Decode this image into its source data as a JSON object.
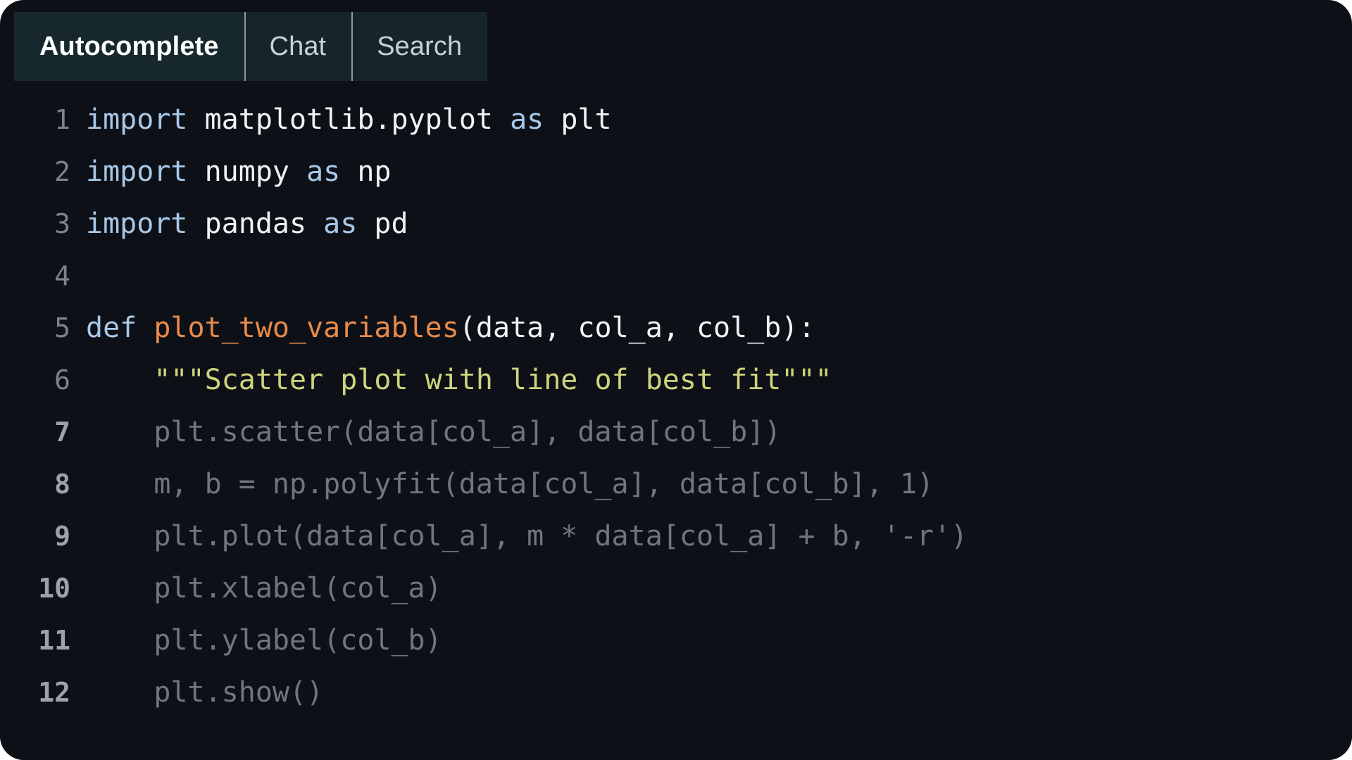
{
  "window": {
    "background_color": "#0d1117",
    "card_radius_px": 34
  },
  "tabs": {
    "active_index": 0,
    "background_color": "#16252b",
    "divider_color": "#8d9aa0",
    "items": [
      {
        "label": "Autocomplete",
        "active": true
      },
      {
        "label": "Chat",
        "active": false
      },
      {
        "label": "Search",
        "active": false
      }
    ]
  },
  "editor": {
    "language": "python",
    "colors": {
      "keyword": "#a8c8e8",
      "plain": "#f0f3f6",
      "function": "#e8894a",
      "docstring": "#cfd37c",
      "ghost_suggestion": "#6e767e",
      "line_number": "#7b848d",
      "line_number_ghost": "#9aa3ab"
    },
    "lines": [
      {
        "number": "1",
        "ghost": false,
        "tokens": [
          {
            "text": "import",
            "type": "kw"
          },
          {
            "text": " matplotlib.pyplot ",
            "type": "plain"
          },
          {
            "text": "as",
            "type": "kw"
          },
          {
            "text": " plt",
            "type": "plain"
          }
        ]
      },
      {
        "number": "2",
        "ghost": false,
        "tokens": [
          {
            "text": "import",
            "type": "kw"
          },
          {
            "text": " numpy ",
            "type": "plain"
          },
          {
            "text": "as",
            "type": "kw"
          },
          {
            "text": " np",
            "type": "plain"
          }
        ]
      },
      {
        "number": "3",
        "ghost": false,
        "tokens": [
          {
            "text": "import",
            "type": "kw"
          },
          {
            "text": " pandas ",
            "type": "plain"
          },
          {
            "text": "as",
            "type": "kw"
          },
          {
            "text": " pd",
            "type": "plain"
          }
        ]
      },
      {
        "number": "4",
        "ghost": false,
        "tokens": []
      },
      {
        "number": "5",
        "ghost": false,
        "tokens": [
          {
            "text": "def",
            "type": "kw"
          },
          {
            "text": " ",
            "type": "plain"
          },
          {
            "text": "plot_two_variables",
            "type": "fn"
          },
          {
            "text": "(data, col_a, col_b):",
            "type": "plain"
          }
        ]
      },
      {
        "number": "6",
        "ghost": false,
        "tokens": [
          {
            "text": "    ",
            "type": "plain"
          },
          {
            "text": "\"\"\"Scatter plot with line of best fit\"\"\"",
            "type": "doc"
          }
        ]
      },
      {
        "number": "7",
        "ghost": true,
        "tokens": [
          {
            "text": "    plt.scatter(data[col_a], data[col_b])",
            "type": "ghost"
          }
        ]
      },
      {
        "number": "8",
        "ghost": true,
        "tokens": [
          {
            "text": "    m, b = np.polyfit(data[col_a], data[col_b], 1)",
            "type": "ghost"
          }
        ]
      },
      {
        "number": "9",
        "ghost": true,
        "tokens": [
          {
            "text": "    plt.plot(data[col_a], m * data[col_a] + b, '-r')",
            "type": "ghost"
          }
        ]
      },
      {
        "number": "10",
        "ghost": true,
        "tokens": [
          {
            "text": "    plt.xlabel(col_a)",
            "type": "ghost"
          }
        ]
      },
      {
        "number": "11",
        "ghost": true,
        "tokens": [
          {
            "text": "    plt.ylabel(col_b)",
            "type": "ghost"
          }
        ]
      },
      {
        "number": "12",
        "ghost": true,
        "tokens": [
          {
            "text": "    plt.show()",
            "type": "ghost"
          }
        ]
      }
    ]
  }
}
